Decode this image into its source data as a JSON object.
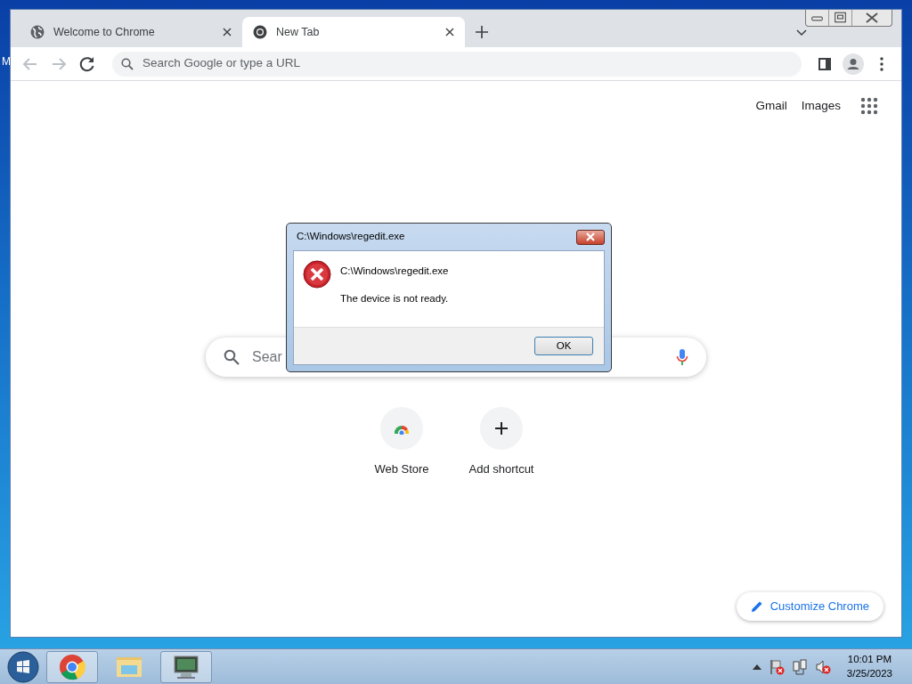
{
  "desktop": {
    "icon_label": "M"
  },
  "browser": {
    "tabs": [
      {
        "title": "Welcome to Chrome",
        "kind": "globe",
        "selected": false
      },
      {
        "title": "New Tab",
        "kind": "chrome",
        "selected": true
      }
    ],
    "address_bar": {
      "placeholder": "Search Google or type a URL"
    },
    "header_links": [
      "Gmail",
      "Images"
    ],
    "search_box": {
      "placeholder": "Sear"
    },
    "shortcuts": [
      {
        "label": "Web Store",
        "kind": "webstore"
      },
      {
        "label": "Add shortcut",
        "kind": "add"
      }
    ],
    "customize_button": "Customize Chrome"
  },
  "dialog": {
    "title": "C:\\Windows\\regedit.exe",
    "heading": "C:\\Windows\\regedit.exe",
    "message": "The device is not ready.",
    "buttons": [
      "OK"
    ]
  },
  "taskbar": {
    "apps": [
      {
        "kind": "chrome"
      },
      {
        "kind": "folder"
      },
      {
        "kind": "monitor"
      }
    ],
    "clock": {
      "time": "10:01 PM",
      "date": "3/25/2023"
    }
  }
}
